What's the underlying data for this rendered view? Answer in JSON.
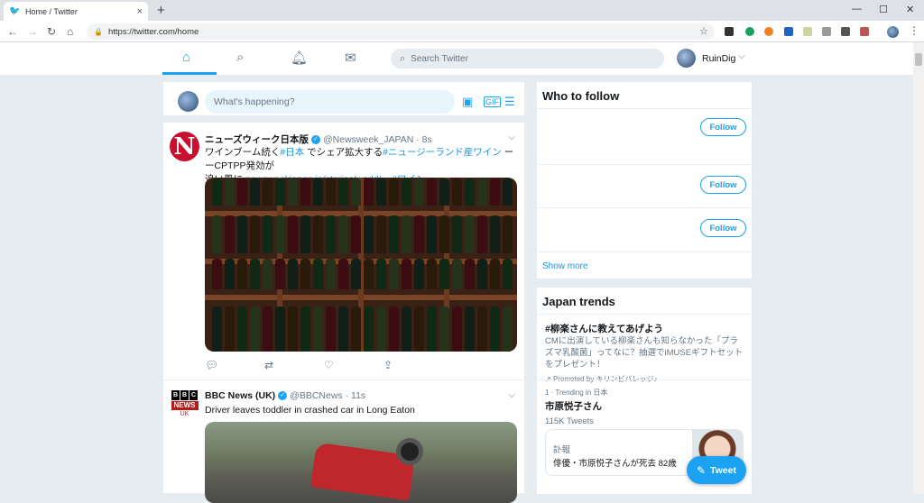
{
  "browser": {
    "tab_title": "Home / Twitter",
    "tab_close": "×",
    "new_tab": "+",
    "url": "https://twitter.com/home",
    "back": "←",
    "forward": "→",
    "reload": "↻",
    "home": "⌂",
    "star": "☆",
    "minimize": "—",
    "maximize": "☐",
    "close": "✕",
    "menu": "⋮"
  },
  "header": {
    "search_placeholder": "Search Twitter",
    "user_name": "RuinDig"
  },
  "compose": {
    "placeholder": "What's happening?"
  },
  "tweets": [
    {
      "name": "ニューズウィーク日本版",
      "handle": "@Newsweek_JAPAN · 8s",
      "text_1": "ワインブーム続く",
      "tag_1": "#日本",
      "text_2": " でシェア拡大する",
      "tag_2": "#ニュージーランド産ワイン",
      "text_3": "   ーーCPTPP発効が",
      "text_4": "追い風に ",
      "url": "newsweekjapan.jp/stories/world/...",
      "tag_3": " #ワイン"
    },
    {
      "name": "BBC News (UK)",
      "handle": "@BBCNews · 11s",
      "text": "Driver leaves toddler in crashed car in Long Eaton",
      "avatar_logo": [
        "B",
        "B",
        "C"
      ],
      "avatar_news": "NEWS",
      "avatar_uk": "UK"
    }
  ],
  "who_to_follow": {
    "title": "Who to follow",
    "follow_label": "Follow",
    "show_more": "Show more"
  },
  "trends": {
    "title": "Japan trends",
    "items": [
      {
        "title": "#柳楽さんに教えてあげよう",
        "desc": "CMに出演している柳楽さんも知らなかった「プラズマ乳酸菌」ってなに？抽選でiMUSEギフトセットをプレゼント！",
        "promoted": "Promoted by キリンビバレッジ♪"
      },
      {
        "meta": "1 · Trending in 日本",
        "title": "市原悦子さん",
        "count": "115K Tweets",
        "card_line1": "訃報",
        "card_line2": "俳優・市原悦子さんが死去 82歳"
      }
    ]
  },
  "tweet_button": "Tweet",
  "colors": {
    "accent": "#1da1f2",
    "background": "#e6ecf0"
  }
}
